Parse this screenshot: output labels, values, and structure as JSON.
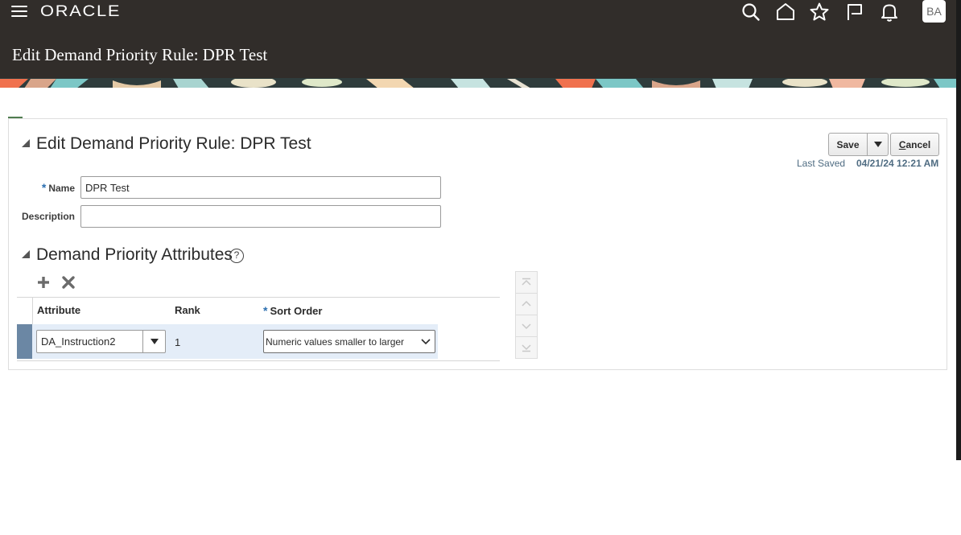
{
  "header": {
    "logo": "ORACLE",
    "title": "Edit Demand Priority Rule: DPR Test",
    "avatar_initials": "BA",
    "icons": [
      "menu-icon",
      "search-icon",
      "home-icon",
      "star-icon",
      "flag-icon",
      "bell-icon"
    ]
  },
  "form": {
    "section_title": "Edit Demand Priority Rule: DPR Test",
    "save_label": "Save",
    "cancel_label": "ancel",
    "cancel_mnemonic": "C",
    "last_saved_label": "Last Saved",
    "last_saved_value": "04/21/24 12:21 AM",
    "name_required": "*",
    "name_label": "Name",
    "name_value": "DPR Test",
    "description_label": "Description",
    "description_value": ""
  },
  "attributes": {
    "section_title": "Demand Priority Attributes",
    "help_symbol": "?",
    "columns": {
      "attribute": "Attribute",
      "rank": "Rank",
      "sort_required": "*",
      "sort_order": "Sort Order"
    },
    "rows": [
      {
        "attribute": "DA_Instruction2",
        "rank": "1",
        "sort_order": "Numeric values smaller to larger"
      }
    ]
  },
  "colors": {
    "header_bg": "#312d2a",
    "selected_row": "#e4edf8",
    "row_selector": "#6b87a4",
    "required": "#2c6fb0",
    "last_saved": "#4f6c82"
  }
}
